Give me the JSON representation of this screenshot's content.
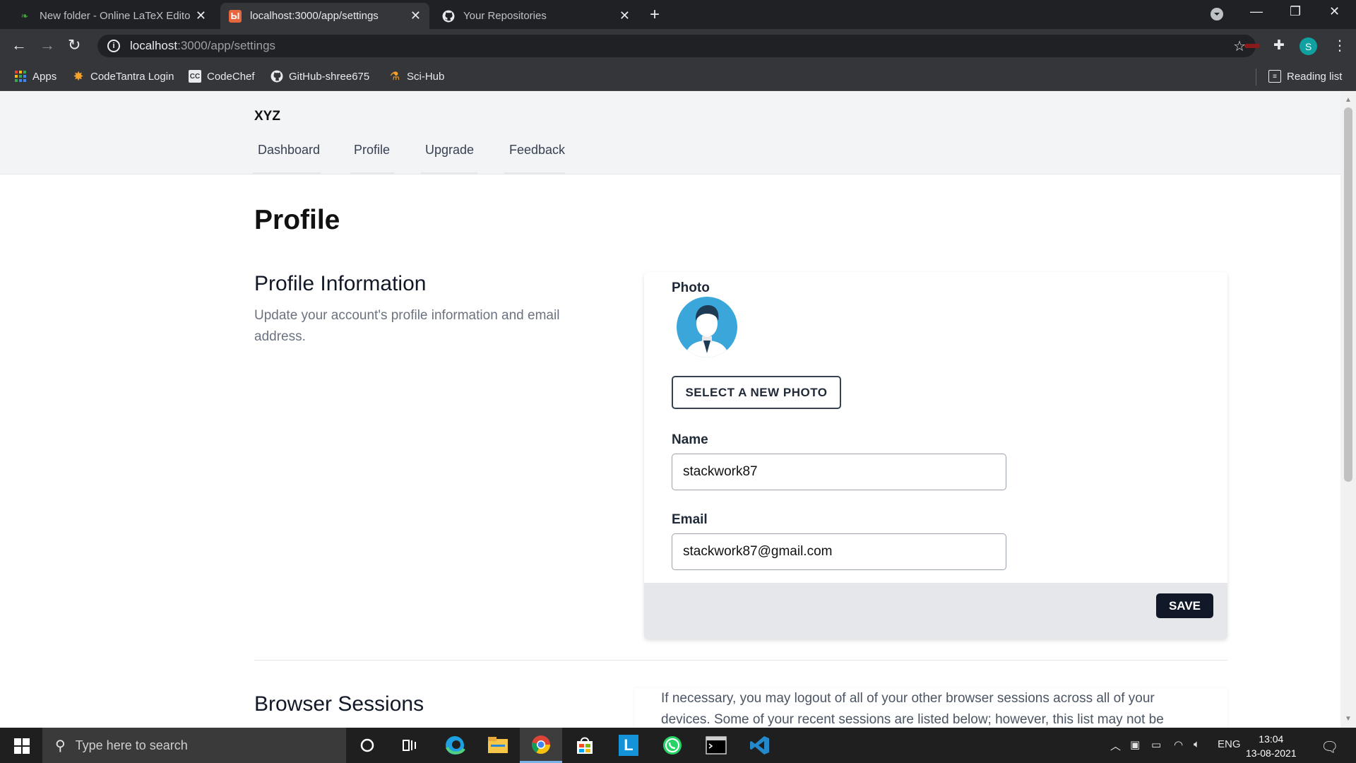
{
  "browser": {
    "tabs": [
      {
        "title": "New folder - Online LaTeX Editor",
        "active": false
      },
      {
        "title": "localhost:3000/app/settings",
        "active": true
      },
      {
        "title": "Your Repositories",
        "active": false
      }
    ],
    "url_host": "localhost",
    "url_path": ":3000/app/settings",
    "profile_initial": "S",
    "bookmarks": [
      "Apps",
      "CodeTantra Login",
      "CodeChef",
      "GitHub-shree675",
      "Sci-Hub"
    ],
    "reading_list": "Reading list"
  },
  "app": {
    "brand": "XYZ",
    "nav": [
      "Dashboard",
      "Profile",
      "Upgrade",
      "Feedback"
    ]
  },
  "page": {
    "title": "Profile",
    "profile_info": {
      "title": "Profile Information",
      "description": "Update your account's profile information and email address.",
      "photo_label": "Photo",
      "photo_button": "SELECT A NEW PHOTO",
      "name_label": "Name",
      "name_value": "stackwork87",
      "email_label": "Email",
      "email_value": "stackwork87@gmail.com",
      "save_button": "SAVE"
    },
    "sessions": {
      "title": "Browser Sessions",
      "text": "If necessary, you may logout of all of your other browser sessions across all of your devices. Some of your recent sessions are listed below; however, this list may not be"
    }
  },
  "taskbar": {
    "search_placeholder": "Type here to search",
    "language": "ENG",
    "time": "13:04",
    "date": "13-08-2021"
  },
  "colors": {
    "accent": "#111827",
    "nav_bg": "#f3f4f6",
    "avatar_bg": "#3aa6d9"
  }
}
